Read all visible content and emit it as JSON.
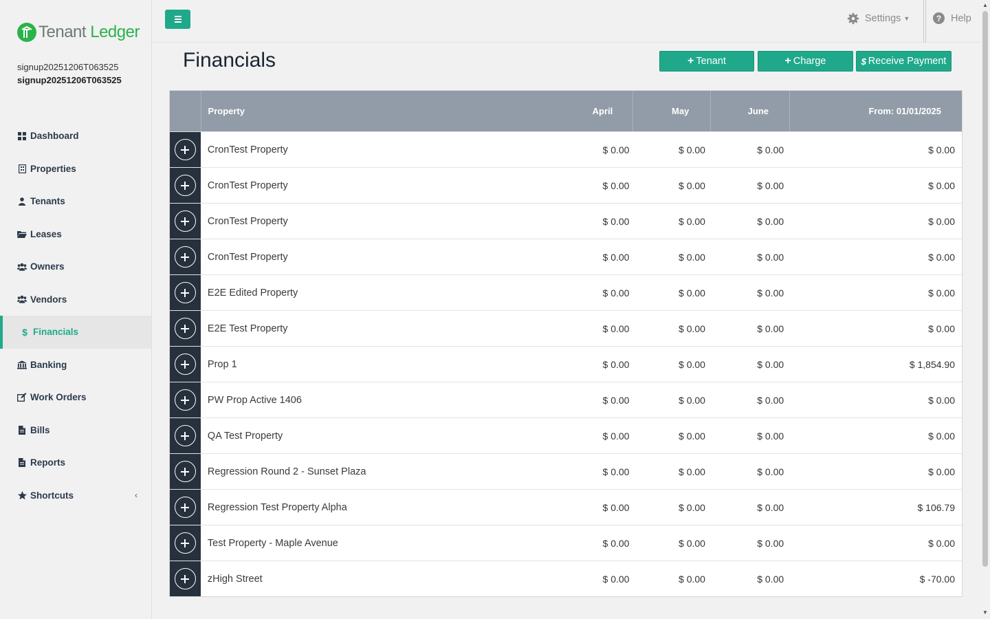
{
  "app": {
    "logo_part1": "Tenant",
    "logo_part2": "Ledger",
    "brand_color": "#2bb24c",
    "accent_color": "#1fa98a"
  },
  "user": {
    "username": "signup20251206T063525",
    "display_name": "signup20251206T063525"
  },
  "sidebar": {
    "items": [
      {
        "label": "Dashboard",
        "icon": "dashboard-icon"
      },
      {
        "label": "Properties",
        "icon": "building-icon"
      },
      {
        "label": "Tenants",
        "icon": "user-icon"
      },
      {
        "label": "Leases",
        "icon": "folder-icon"
      },
      {
        "label": "Owners",
        "icon": "users-icon"
      },
      {
        "label": "Vendors",
        "icon": "users-icon"
      },
      {
        "label": "Financials",
        "icon": "dollar-icon",
        "active": true
      },
      {
        "label": "Banking",
        "icon": "bank-icon"
      },
      {
        "label": "Work Orders",
        "icon": "edit-icon"
      },
      {
        "label": "Bills",
        "icon": "file-icon"
      },
      {
        "label": "Reports",
        "icon": "file-icon"
      },
      {
        "label": "Shortcuts",
        "icon": "star-icon"
      }
    ]
  },
  "topbar": {
    "settings_label": "Settings",
    "help_label": "Help"
  },
  "page": {
    "title": "Financials",
    "buttons": {
      "tenant": "Tenant",
      "charge": "Charge",
      "receive_payment": "Receive Payment"
    }
  },
  "table": {
    "headers": {
      "property": "Property",
      "m1": "April",
      "m2": "May",
      "m3": "June",
      "from": "From: 01/01/2025"
    },
    "rows": [
      {
        "property": "CronTest Property",
        "m1": "$ 0.00",
        "m2": "$ 0.00",
        "m3": "$ 0.00",
        "total": "$ 0.00"
      },
      {
        "property": "CronTest Property",
        "m1": "$ 0.00",
        "m2": "$ 0.00",
        "m3": "$ 0.00",
        "total": "$ 0.00"
      },
      {
        "property": "CronTest Property",
        "m1": "$ 0.00",
        "m2": "$ 0.00",
        "m3": "$ 0.00",
        "total": "$ 0.00"
      },
      {
        "property": "CronTest Property",
        "m1": "$ 0.00",
        "m2": "$ 0.00",
        "m3": "$ 0.00",
        "total": "$ 0.00"
      },
      {
        "property": "E2E Edited Property",
        "m1": "$ 0.00",
        "m2": "$ 0.00",
        "m3": "$ 0.00",
        "total": "$ 0.00"
      },
      {
        "property": "E2E Test Property",
        "m1": "$ 0.00",
        "m2": "$ 0.00",
        "m3": "$ 0.00",
        "total": "$ 0.00"
      },
      {
        "property": "Prop 1",
        "m1": "$ 0.00",
        "m2": "$ 0.00",
        "m3": "$ 0.00",
        "total": "$ 1,854.90"
      },
      {
        "property": "PW Prop Active 1406",
        "m1": "$ 0.00",
        "m2": "$ 0.00",
        "m3": "$ 0.00",
        "total": "$ 0.00"
      },
      {
        "property": "QA Test Property",
        "m1": "$ 0.00",
        "m2": "$ 0.00",
        "m3": "$ 0.00",
        "total": "$ 0.00"
      },
      {
        "property": "Regression Round 2 - Sunset Plaza",
        "m1": "$ 0.00",
        "m2": "$ 0.00",
        "m3": "$ 0.00",
        "total": "$ 0.00"
      },
      {
        "property": "Regression Test Property Alpha",
        "m1": "$ 0.00",
        "m2": "$ 0.00",
        "m3": "$ 0.00",
        "total": "$ 106.79"
      },
      {
        "property": "Test Property - Maple Avenue",
        "m1": "$ 0.00",
        "m2": "$ 0.00",
        "m3": "$ 0.00",
        "total": "$ 0.00"
      },
      {
        "property": "zHigh Street",
        "m1": "$ 0.00",
        "m2": "$ 0.00",
        "m3": "$ 0.00",
        "total": "$ -70.00"
      }
    ]
  }
}
